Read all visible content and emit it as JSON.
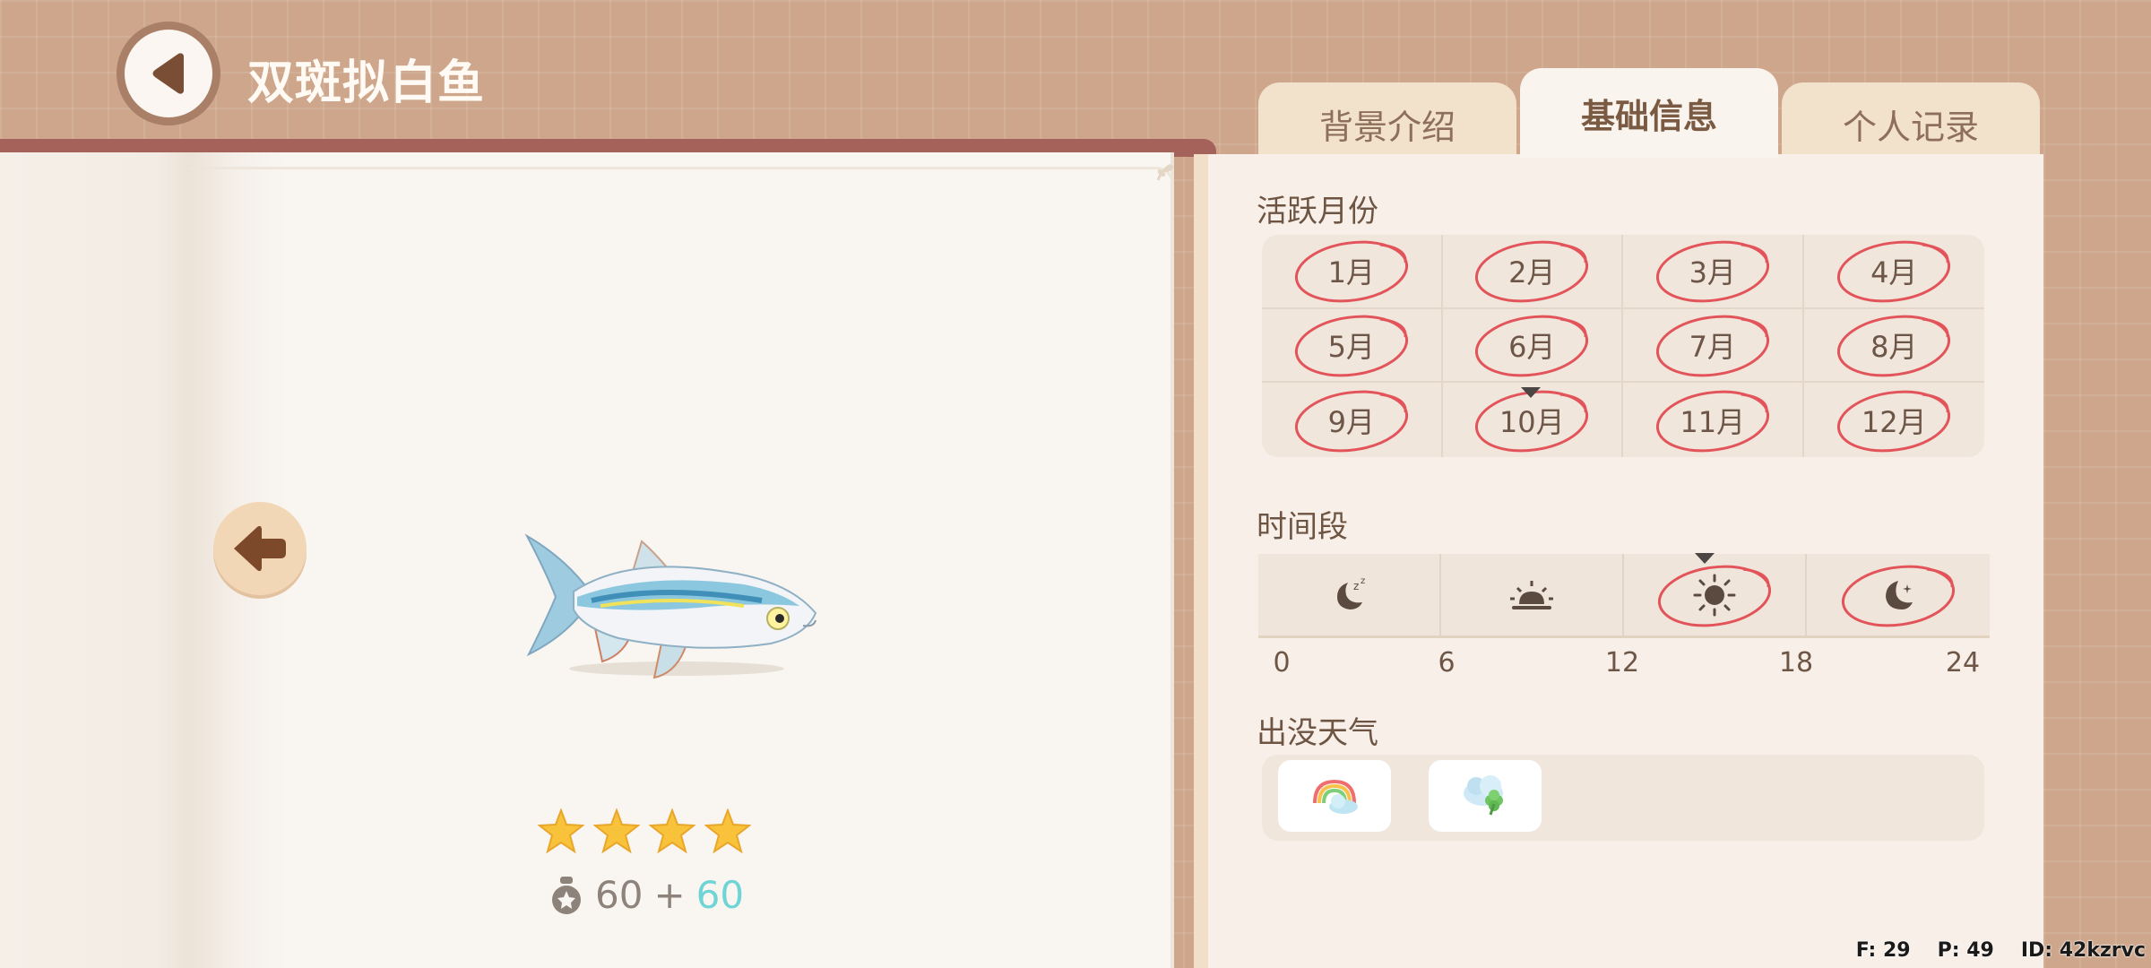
{
  "header": {
    "title": "双斑拟白鱼"
  },
  "tabs": [
    {
      "label": "背景介绍"
    },
    {
      "label": "基础信息"
    },
    {
      "label": "个人记录"
    }
  ],
  "active_tab": "基础信息",
  "sections": {
    "months_label": "活跃月份",
    "time_label": "时间段",
    "weather_label": "出没天气"
  },
  "months": [
    "1月",
    "2月",
    "3月",
    "4月",
    "5月",
    "6月",
    "7月",
    "8月",
    "9月",
    "10月",
    "11月",
    "12月"
  ],
  "active_months": [
    "1月",
    "2月",
    "3月",
    "4月",
    "5月",
    "6月",
    "7月",
    "8月",
    "9月",
    "10月",
    "11月",
    "12月"
  ],
  "current_month": "10月",
  "time_slots": [
    {
      "icon": "sleeping-moon-icon",
      "active": false
    },
    {
      "icon": "sunrise-icon",
      "active": false
    },
    {
      "icon": "sun-icon",
      "active": true,
      "current": true
    },
    {
      "icon": "night-moon-icon",
      "active": true
    }
  ],
  "time_ticks": [
    "0",
    "6",
    "12",
    "18",
    "24"
  ],
  "weather": [
    {
      "icon": "rainbow-cloud-icon"
    },
    {
      "icon": "clover-cloud-icon"
    }
  ],
  "fish": {
    "name_icon": "fish-icon",
    "stars": 4,
    "base_value": "60",
    "plus": "+",
    "bonus_value": "60"
  },
  "colors": {
    "circle": "#e2545a",
    "bonus": "#6ed4d4",
    "star": "#f8c33a"
  },
  "debug": {
    "f": "F: 29",
    "p": "P: 49",
    "id": "ID: 42kzrvc"
  }
}
